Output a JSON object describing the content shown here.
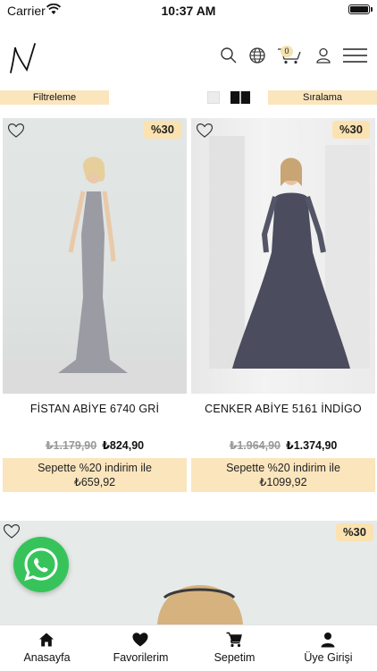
{
  "status_bar": {
    "carrier": "Carrier",
    "time": "10:37 AM"
  },
  "header": {
    "cart_count": "0"
  },
  "filter_bar": {
    "filter_label": "Filtreleme",
    "sort_label": "Sıralama"
  },
  "products": [
    {
      "name": "FİSTAN ABİYE 6740 GRİ",
      "discount": "%30",
      "old_price": "₺1.179,90",
      "new_price": "₺824,90",
      "promo_line1": "Sepette %20 indirim ile",
      "promo_line2": "₺659,92"
    },
    {
      "name": "CENKER ABİYE 5161 İNDİGO",
      "discount": "%30",
      "old_price": "₺1.964,90",
      "new_price": "₺1.374,90",
      "promo_line1": "Sepette %20 indirim ile",
      "promo_line2": "₺1099,92"
    },
    {
      "discount": "%30"
    }
  ],
  "tab_bar": {
    "items": [
      {
        "label": "Anasayfa",
        "icon": "home-icon"
      },
      {
        "label": "Favorilerim",
        "icon": "heart-icon"
      },
      {
        "label": "Sepetim",
        "icon": "cart-icon"
      },
      {
        "label": "Üye Girişi",
        "icon": "user-icon"
      }
    ]
  },
  "colors": {
    "accent": "#fbe5bd",
    "whatsapp": "#36c45a"
  }
}
